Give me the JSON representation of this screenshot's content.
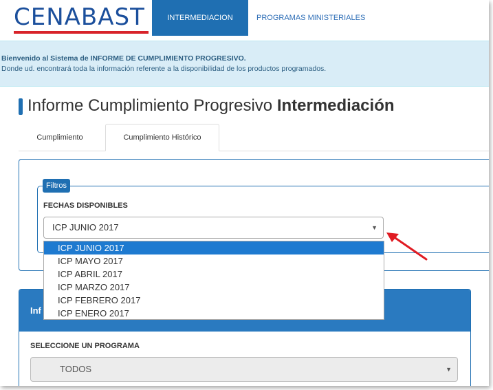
{
  "header": {
    "logo_text": "CENABAST",
    "nav_active": "INTERMEDIACION",
    "nav_item": "PROGRAMAS MINISTERIALES"
  },
  "banner": {
    "line1": "Bienvenido al Sistema de INFORME DE CUMPLIMIENTO PROGRESIVO.",
    "line2": "Donde ud. encontrará toda la información referente a la disponibilidad de los productos programados."
  },
  "page": {
    "title_regular": "Informe Cumplimiento Progresivo ",
    "title_bold": "Intermediación"
  },
  "tabs": [
    {
      "label": "Cumplimiento"
    },
    {
      "label": "Cumplimiento Histórico"
    }
  ],
  "filters": {
    "legend": "Filtros",
    "dates_label": "FECHAS DISPONIBLES",
    "selected_value": "ICP JUNIO 2017",
    "options": [
      "ICP JUNIO 2017",
      "ICP MAYO 2017",
      "ICP ABRIL 2017",
      "ICP MARZO 2017",
      "ICP FEBRERO 2017",
      "ICP ENERO 2017"
    ]
  },
  "program_panel": {
    "title_visible": "Inf",
    "program_label": "SELECCIONE UN PROGRAMA",
    "program_value": "TODOS"
  },
  "colors": {
    "brand_blue": "#1f6fb2",
    "logo_blue": "#1b4f9c",
    "logo_red": "#d8232a",
    "selected_option": "#1e7ad0",
    "annotation_arrow": "#e01b22"
  },
  "icons": {
    "select_caret": "▼"
  }
}
